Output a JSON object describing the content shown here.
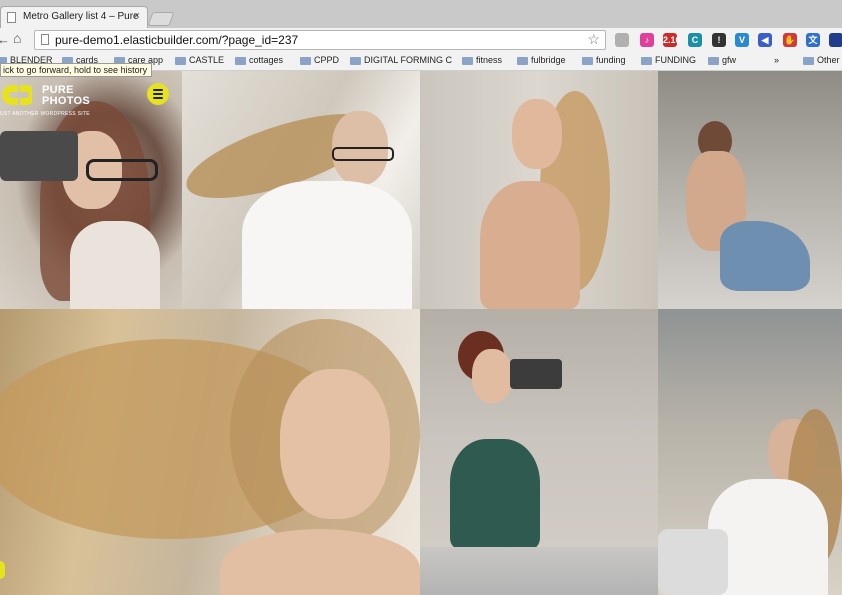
{
  "browser": {
    "tab": {
      "title": "Metro Gallery list 4 – Pure",
      "close": "×"
    },
    "url": "pure-demo1.elasticbuilder.com/?page_id=237",
    "nav": {
      "back": "←",
      "home": "⌂"
    },
    "star": "☆",
    "tooltip": "ick to go forward, hold to see history",
    "bookmarks": [
      {
        "label": "BLENDER"
      },
      {
        "label": "cards"
      },
      {
        "label": "care app"
      },
      {
        "label": "CASTLE"
      },
      {
        "label": "cottages"
      },
      {
        "label": "CPPD"
      },
      {
        "label": "DIGITAL FORMING C"
      },
      {
        "label": "fitness"
      },
      {
        "label": "fulbridge"
      },
      {
        "label": "funding"
      },
      {
        "label": "FUNDING"
      },
      {
        "label": "gfw"
      },
      {
        "label": "Other"
      }
    ],
    "overflow": "»",
    "extensions": [
      {
        "name": "extension-gray-icon",
        "color": "#b0b0b0",
        "text": ""
      },
      {
        "name": "itunes-icon",
        "color": "#e0409a",
        "text": "♪"
      },
      {
        "name": "badge-icon",
        "color": "#cc2b2b",
        "text": "2.16"
      },
      {
        "name": "c-extension-icon",
        "color": "#1b8fa8",
        "text": "C"
      },
      {
        "name": "info-icon",
        "color": "#333333",
        "text": "!"
      },
      {
        "name": "shield-icon",
        "color": "#2a8ad0",
        "text": "V"
      },
      {
        "name": "megaphone-icon",
        "color": "#3a5fc8",
        "text": "◀"
      },
      {
        "name": "stop-icon",
        "color": "#d03a3a",
        "text": "✋"
      },
      {
        "name": "translate-icon",
        "color": "#2f6fd1",
        "text": "文"
      },
      {
        "name": "flag-icon",
        "color": "#1f3d8a",
        "text": ""
      }
    ]
  },
  "site": {
    "name_line1": "PURE",
    "name_line2": "PHOTOS",
    "tagline": "UST ANOTHER WORDPRESS SITE",
    "accent": "#e6e21e"
  }
}
